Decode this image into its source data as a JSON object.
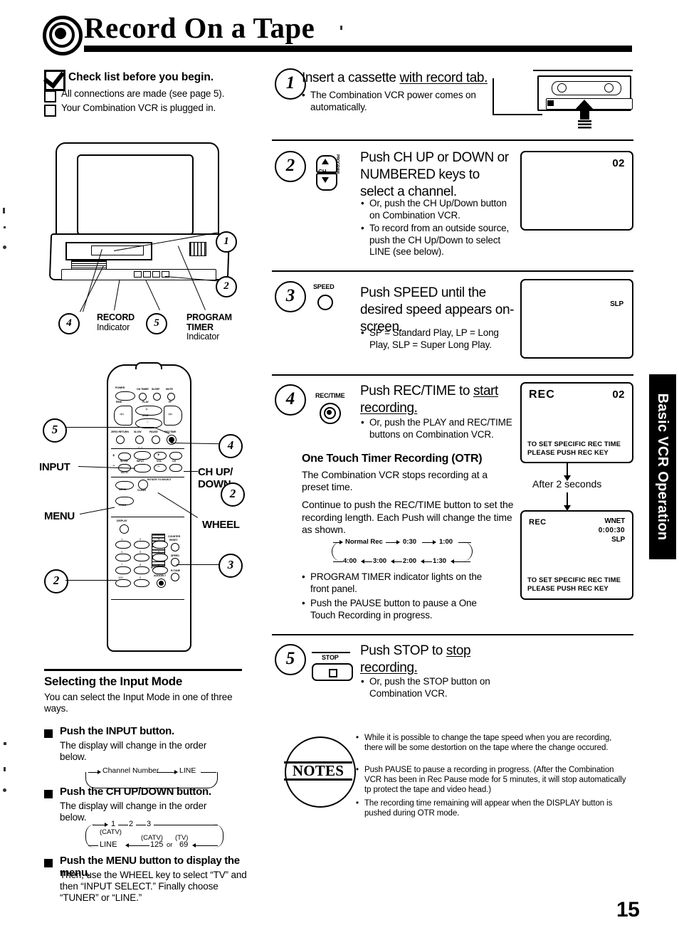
{
  "page": {
    "title": "Record On a Tape",
    "number": "15",
    "side_tab": "Basic VCR Operation"
  },
  "checklist": {
    "heading": "Check list before you begin.",
    "items": [
      "All connections are made (see page 5).",
      "Your Combination VCR is plugged in."
    ]
  },
  "tv_diagram": {
    "callouts": [
      "1",
      "2",
      "4",
      "5"
    ],
    "record_label": "RECORD",
    "record_sub": "Indicator",
    "program_label": "PROGRAM",
    "program_label2": "TIMER",
    "program_sub": "Indicator"
  },
  "remote": {
    "labels": {
      "input": "INPUT",
      "menu": "MENU",
      "ch_up_down": "CH UP/",
      "ch_up_down2": "DOWN",
      "wheel": "WHEEL"
    },
    "callouts": {
      "five": "5",
      "four": "4",
      "two_b": "2",
      "two_c": "2",
      "three": "3"
    },
    "keys": {
      "power": "POWER",
      "on_timer": "ON TIMER",
      "sleep": "SLEEP",
      "mute": "MUTE",
      "rew": "REW",
      "play": "PLAY",
      "ff": "FF",
      "stop": "STOP",
      "zero_return": "ZERO RETURN",
      "slow": "SLOW",
      "pause": "PAUSE",
      "rec_time": "REC/TIME",
      "cc": "C. C.",
      "slow_tracking": "SLOW",
      "auto": "AUTO",
      "input": "INPUT",
      "vol": "VOL",
      "ch": "CH",
      "menu": "MENU",
      "rotate_to_select": "ROTATE TO SELECT",
      "clear": "CLEAR",
      "prog": "PROG",
      "push_to_set": "PUSH TO SET",
      "display": "DISPLAY",
      "counter_reset": "COUNTER RESET",
      "speed": "SPEED",
      "r_tune": "R-TUNE",
      "add_del": "ADD/DELT",
      "hundred": "100",
      "zero": "0",
      "numbers": [
        "1",
        "2",
        "3",
        "4",
        "5",
        "6",
        "7",
        "8",
        "9"
      ]
    }
  },
  "input_mode": {
    "heading": "Selecting the Input Mode",
    "intro": "You can select the Input Mode in one of three ways.",
    "bullets": [
      {
        "title": "Push the INPUT button.",
        "sub": "The display will change in the order below."
      },
      {
        "title": "Push the CH UP/DOWN button.",
        "sub": "The display will change in the order below."
      },
      {
        "title": "Push the MENU button to display the menu.",
        "sub": "Then, use the WHEEL key to select “TV” and then “INPUT SELECT.” Finally choose “TUNER” or “LINE.”"
      }
    ],
    "flow1": {
      "a": "Channel Number",
      "b": "LINE"
    },
    "flow2": {
      "top": [
        "1",
        "2",
        "3"
      ],
      "bottom": [
        "LINE",
        "125",
        "or",
        "69"
      ],
      "notes": [
        "(CATV)",
        "(CATV)",
        "(TV)"
      ]
    }
  },
  "steps": [
    {
      "num": "1",
      "title_pre": "Insert a cassette ",
      "title_underlined": "with record tab.",
      "bullets": [
        "The Combination VCR power comes on automatically."
      ]
    },
    {
      "num": "2",
      "icon_label": "CH",
      "icon_side": "PROGRAM",
      "title": "Push CH UP or DOWN or NUMBERED keys to select a channel.",
      "bullets": [
        "Or, push the CH Up/Down button on Combination VCR.",
        "To record from an outside source, push the CH Up/Down to select LINE (see below)."
      ],
      "osd": {
        "channel": "02"
      }
    },
    {
      "num": "3",
      "icon_label": "SPEED",
      "title": "Push SPEED until the desired speed appears on-screen.",
      "bullets": [
        "SP = Standard Play, LP = Long Play, SLP = Super Long Play."
      ],
      "osd": {
        "speed": "SLP"
      }
    },
    {
      "num": "4",
      "icon_label": "REC/TIME",
      "title_pre": "Push REC/TIME to ",
      "title_underlined": "start recording.",
      "bullets": [
        "Or, push the PLAY and REC/TIME buttons on Combination VCR."
      ],
      "otr": {
        "heading": "One Touch Timer Recording (OTR)",
        "p1": "The Combination VCR stops recording at a preset time.",
        "p2": "Continue to push the REC/TIME button to set the recording length. Each Push will change the time as shown.",
        "cycle_top": [
          "Normal Rec",
          "0:30",
          "1:00"
        ],
        "cycle_bottom": [
          "4:00",
          "3:00",
          "2:00",
          "1:30"
        ],
        "bullets": [
          "PROGRAM TIMER indicator lights on the front panel.",
          "Push the PAUSE button to pause a One Touch Recording in progress."
        ]
      },
      "osd1": {
        "mode": "REC",
        "channel": "02",
        "footer_line1": "TO SET SPECIFIC REC TIME",
        "footer_line2": "PLEASE PUSH REC KEY"
      },
      "transition": "After 2 seconds",
      "osd2": {
        "mode": "REC",
        "network": "WNET",
        "time": "0:00:30",
        "speed": "SLP",
        "footer_line1": "TO SET SPECIFIC REC TIME",
        "footer_line2": "PLEASE PUSH REC KEY"
      }
    },
    {
      "num": "5",
      "icon_label": "STOP",
      "title_pre": "Push STOP to ",
      "title_underlined": "stop recording.",
      "bullets": [
        "Or, push the STOP button on Combination VCR."
      ]
    }
  ],
  "notes": {
    "label": "NOTES",
    "items": [
      "While it is possible to change the tape speed when you are recording, there will be some destortion on the tape where the change occured.",
      "Push PAUSE to pause a recording in progress. (After the Combination VCR has been in Rec Pause mode for 5 minutes, it will stop automatically tp protect the tape and video head.)",
      "The recording time remaining will appear when the DISPLAY button is pushed during OTR mode."
    ]
  }
}
